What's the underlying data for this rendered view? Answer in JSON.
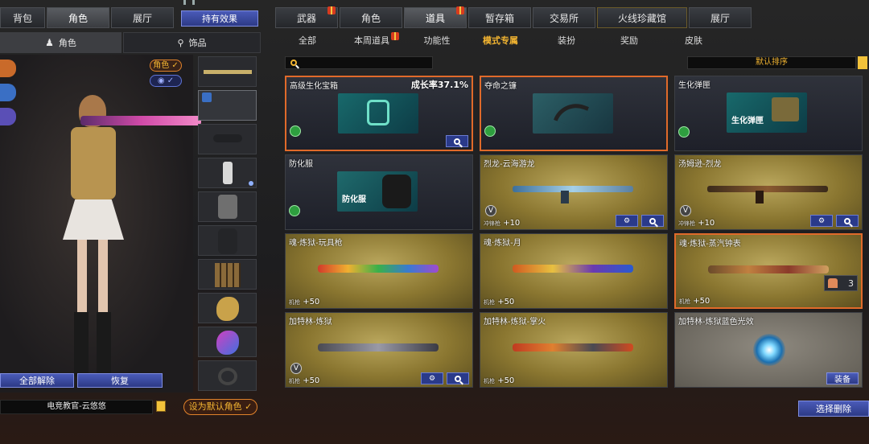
{
  "left": {
    "tabs": [
      "背包",
      "角色",
      "展厅"
    ],
    "holding_effect": "持有效果",
    "subtabs": [
      "角色",
      "饰品"
    ],
    "role_badge": "角色",
    "unequip_all": "全部解除",
    "restore": "恢复",
    "char_name": "电竞教官-云悠悠",
    "set_default": "设为默认角色"
  },
  "right": {
    "tabs": [
      "武器",
      "角色",
      "道具",
      "暂存箱",
      "交易所",
      "火线珍藏馆",
      "展厅"
    ],
    "subtabs": [
      "全部",
      "本周道具",
      "功能性",
      "模式专属",
      "装扮",
      "奖励",
      "皮肤"
    ],
    "sort_label": "默认排序",
    "select_delete": "选择删除",
    "cards": [
      {
        "title": "高级生化宝箱",
        "right": "成长率37.1%"
      },
      {
        "title": "夺命之镰"
      },
      {
        "title": "生化弹匣",
        "thumb_label": "生化弹匣"
      },
      {
        "title": "防化服",
        "thumb_label": "防化服"
      },
      {
        "title": "烈龙-云海游龙",
        "stat_label": "冲锋枪",
        "stat": "+10"
      },
      {
        "title": "汤姆逊-烈龙",
        "stat_label": "冲锋枪",
        "stat": "+10"
      },
      {
        "title": "魂·炼狱-玩具枪",
        "stat_label": "机枪",
        "stat": "+50"
      },
      {
        "title": "魂·炼狱-月",
        "stat_label": "机枪",
        "stat": "+50"
      },
      {
        "title": "魂·炼狱-蒸汽钟表",
        "stat_label": "机枪",
        "stat": "+50",
        "count": "3"
      },
      {
        "title": "加特林-炼狱",
        "stat_label": "机枪",
        "stat": "+50"
      },
      {
        "title": "加特林-炼狱-掌火",
        "stat_label": "机枪",
        "stat": "+50"
      },
      {
        "title": "加特林-炼狱蓝色光效",
        "equip": "装备"
      }
    ]
  },
  "colors": {
    "accent": "#f2b431",
    "selected_border": "#e06a2a",
    "button_blue": "#2d3a86"
  }
}
